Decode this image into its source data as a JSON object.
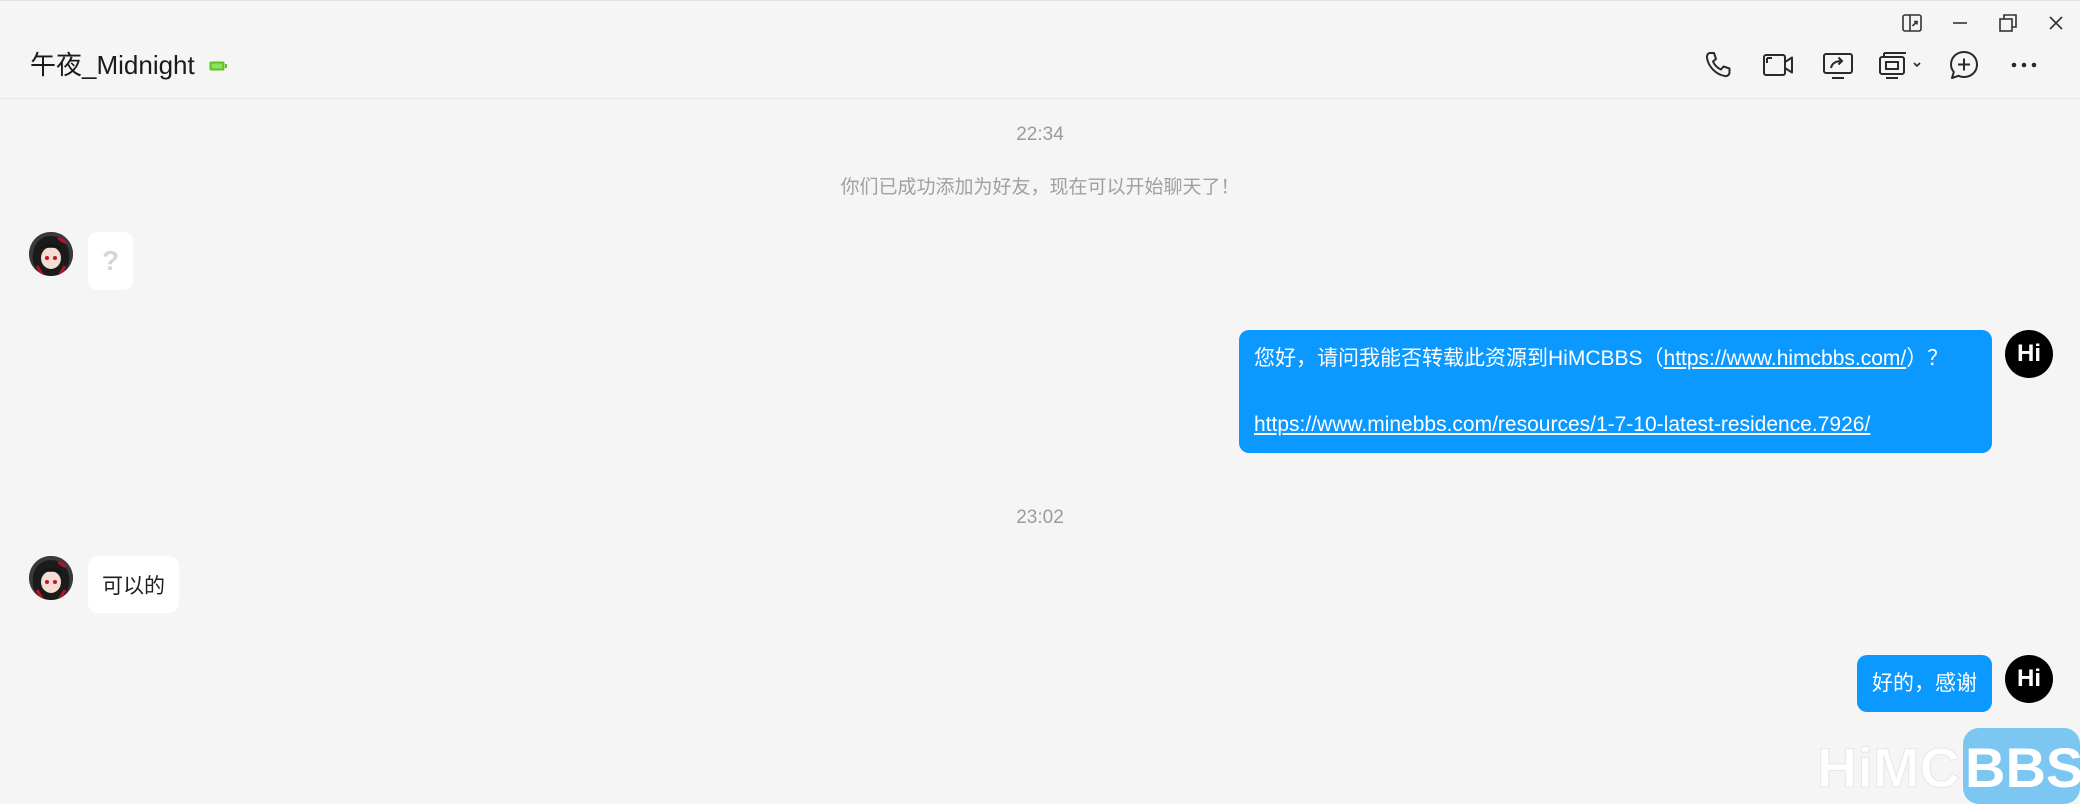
{
  "header": {
    "title": "午夜_Midnight"
  },
  "colors": {
    "bubble_self": "#0c99ff",
    "bubble_other": "#ffffff",
    "background": "#f5f5f5",
    "status": "#58c322"
  },
  "icons": {
    "status": "battery-status-icon",
    "toolbar": [
      "phone-icon",
      "video-call-icon",
      "screen-share-icon",
      "remote-assist-icon",
      "add-member-icon",
      "more-icon"
    ],
    "window": [
      "pin-icon",
      "minimize-icon",
      "restore-icon",
      "close-icon"
    ]
  },
  "messages": {
    "time1": "22:34",
    "system": "你们已成功添加为好友，现在可以开始聊天了！",
    "m1_text": "?",
    "m2_prefix": "您好，请问我能否转载此资源到HiMCBBS（",
    "m2_link1": "https://www.himcbbs.com/",
    "m2_suffix": "）？",
    "m2_link2": "https://www.minebbs.com/resources/1-7-10-latest-residence.7926/",
    "time2": "23:02",
    "m3_text": "可以的",
    "m4_text": "好的，感谢",
    "self_avatar": "Hi"
  },
  "watermark": {
    "left": "HiMC",
    "right": "BBS"
  }
}
